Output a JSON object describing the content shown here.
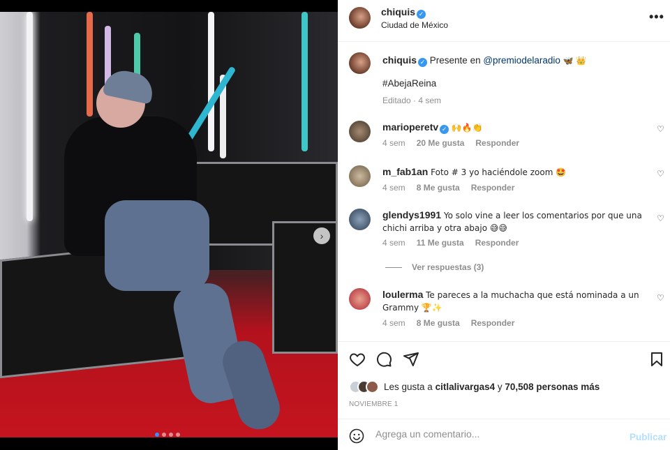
{
  "post": {
    "author": "chiquis",
    "location": "Ciudad de México",
    "more_icon": "more-options-icon",
    "verified_icon": "verified-badge-icon"
  },
  "caption": {
    "author": "chiquis",
    "text_prefix": "Presente en ",
    "mention": "@premiodelaradio",
    "emojis": "🦋 👑",
    "hashtag": "#AbejaReina",
    "meta": "Editado · 4 sem"
  },
  "comments": [
    {
      "author": "marioperetv",
      "verified": true,
      "text": "🙌🔥👏",
      "age": "4 sem",
      "likes": "20 Me gusta",
      "reply": "Responder"
    },
    {
      "author": "m_fab1an",
      "verified": false,
      "text": "Foto # 3 yo haciéndole zoom 🤩",
      "age": "4 sem",
      "likes": "8 Me gusta",
      "reply": "Responder"
    },
    {
      "author": "glendys1991",
      "verified": false,
      "text": "Yo solo vine a leer los comentarios por que una chichi arriba y otra abajo 😅😅",
      "age": "4 sem",
      "likes": "11 Me gusta",
      "reply": "Responder"
    },
    {
      "author": "loulerma",
      "verified": false,
      "text": "Te pareces a la muchacha que está nominada a un Grammy 🏆✨",
      "age": "4 sem",
      "likes": "8 Me gusta",
      "reply": "Responder"
    }
  ],
  "view_replies": "Ver respuestas (3)",
  "likes": {
    "prefix": "Les gusta a ",
    "user": "citlalivargas4",
    "middle": " y ",
    "count": "70,508 personas más"
  },
  "date": "NOVIEMBRE 1",
  "composer": {
    "placeholder": "Agrega un comentario...",
    "publish": "Publicar"
  },
  "carousel": {
    "slide_count": 4,
    "active_index": 0
  }
}
